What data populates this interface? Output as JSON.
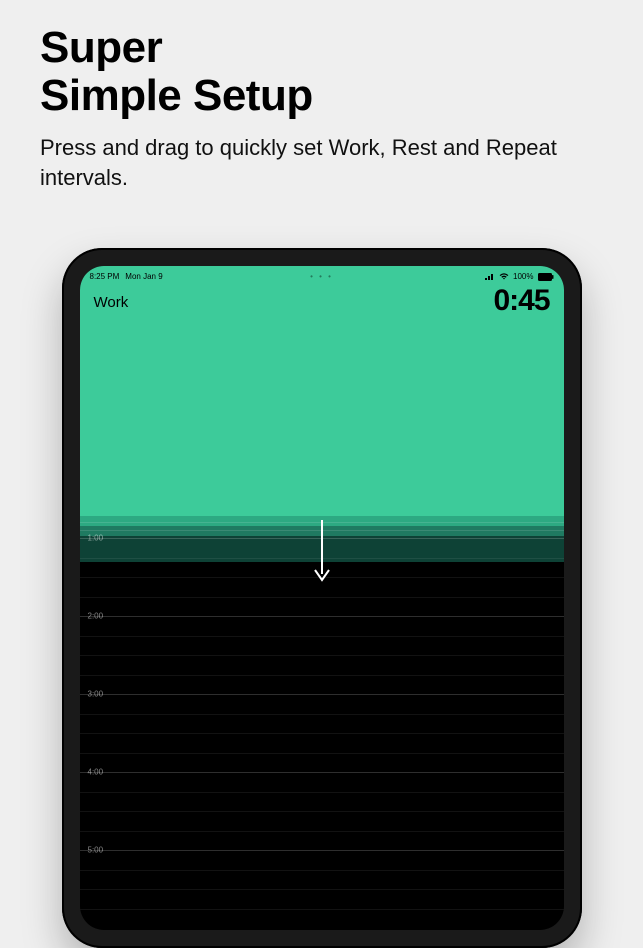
{
  "promo": {
    "headline_line1": "Super",
    "headline_line2": "Simple Setup",
    "subhead": "Press and drag to quickly set Work, Rest and Repeat intervals."
  },
  "statusbar": {
    "time": "8:25 PM",
    "date": "Mon Jan 9",
    "dots": "• • •",
    "battery_pct": "100%"
  },
  "timer": {
    "mode_label": "Work",
    "value": "0:45"
  },
  "ticks": {
    "labels": [
      "1:00",
      "2:00",
      "3:00",
      "4:00",
      "5:00"
    ]
  },
  "colors": {
    "accent": "#3dcb9a"
  }
}
